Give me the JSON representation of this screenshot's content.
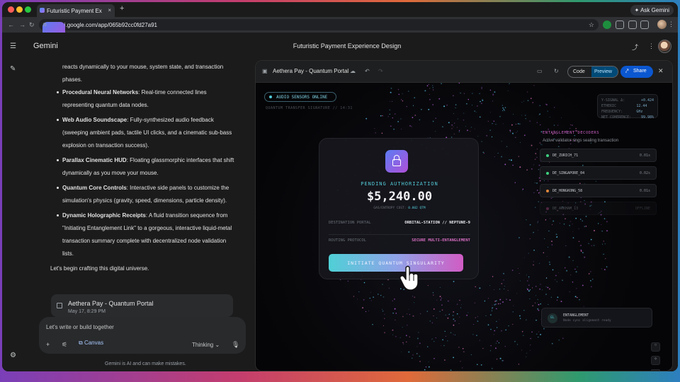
{
  "browser": {
    "tab_title": "Futuristic Payment Ex",
    "new_tab": "+",
    "tab_close": "×",
    "ask_gemini": "Ask Gemini",
    "url": "gemini.google.com/app/065b92cc0fd27a91"
  },
  "app": {
    "name": "Gemini",
    "conversation_title": "Futuristic Payment Experience Design"
  },
  "chat": {
    "intro": "reacts dynamically to your mouse, system state, and transaction phases.",
    "bullets": [
      {
        "title": "Procedural Neural Networks",
        "text": ": Real-time connected lines representing quantum data nodes."
      },
      {
        "title": "Web Audio Soundscape",
        "text": ": Fully-synthesized audio feedback (sweeping ambient pads, tactile UI clicks, and a cinematic sub-bass explosion on transaction success)."
      },
      {
        "title": "Parallax Cinematic HUD",
        "text": ": Floating glassmorphic interfaces that shift dynamically as you move your mouse."
      },
      {
        "title": "Quantum Core Controls",
        "text": ": Interactive side panels to customize the simulation's physics (gravity, speed, dimensions, particle density)."
      },
      {
        "title": "Dynamic Holographic Receipts",
        "text": ": A fluid transition sequence from \"Initiating Entanglement Link\" to a gorgeous, interactive liquid-metal transaction summary complete with decentralized node validation lists."
      }
    ],
    "closing": "Let's begin crafting this digital universe.",
    "artifact_title": "Aethera Pay - Quantum Portal",
    "artifact_date": "May 17, 8:29 PM"
  },
  "composer": {
    "placeholder": "Let's write or build together",
    "canvas_label": "Canvas",
    "mode_label": "Thinking",
    "disclaimer": "Gemini is AI and can make mistakes."
  },
  "canvas": {
    "title": "Aethera Pay - Quantum Portal",
    "code_label": "Code",
    "preview_label": "Preview",
    "share_label": "Share"
  },
  "portal": {
    "audio_badge": "AUDIO SENSORS ONLINE",
    "quantum_line": "QUANTUM TRANSFER SIGNATURE // 14:31",
    "stats": [
      {
        "k": "Y-SIGNAL Δ:",
        "v": "+0.424"
      },
      {
        "k": "ETHERIC FREQUENCY:",
        "v": "12.44 GHz"
      },
      {
        "k": "NET COHERENCE:",
        "v": "99.98%"
      }
    ],
    "status": "PENDING AUTHORIZATION",
    "amount": "$5,240.00",
    "gas_label": "GAS/ENTROPY COST:",
    "gas_value": "0.002 QTM",
    "dest_label": "DESTINATION PORTAL",
    "dest_value": "ORBITAL-STATION // NEPTUNE-9",
    "route_label": "ROUTING PROTOCOL",
    "route_value": "SECURE MULTI-ENTANGLEMENT",
    "cta": "INITIATE QUANTUM SINGULARITY",
    "decoders_title": "ENTANGLEMENT DECODERS",
    "decoders_sub": "Active validator rings sealing transaction",
    "nodes": [
      {
        "name": "DE_ZURICH_71",
        "val": "0.01s",
        "color": "#3fd17f"
      },
      {
        "name": "DE_SINGAPORE_04",
        "val": "0.02s",
        "color": "#3fd17f"
      },
      {
        "name": "DE_HONGKONG_58",
        "val": "0.01s",
        "color": "#e0873a"
      },
      {
        "name": "DE_ARKHAM_13",
        "val": "OFFLINE",
        "color": "#d15ca0"
      }
    ],
    "ent_badge": "EL",
    "ent_title": "ENTANGLEMENT",
    "ent_sub": "Node sync alignment ready"
  }
}
